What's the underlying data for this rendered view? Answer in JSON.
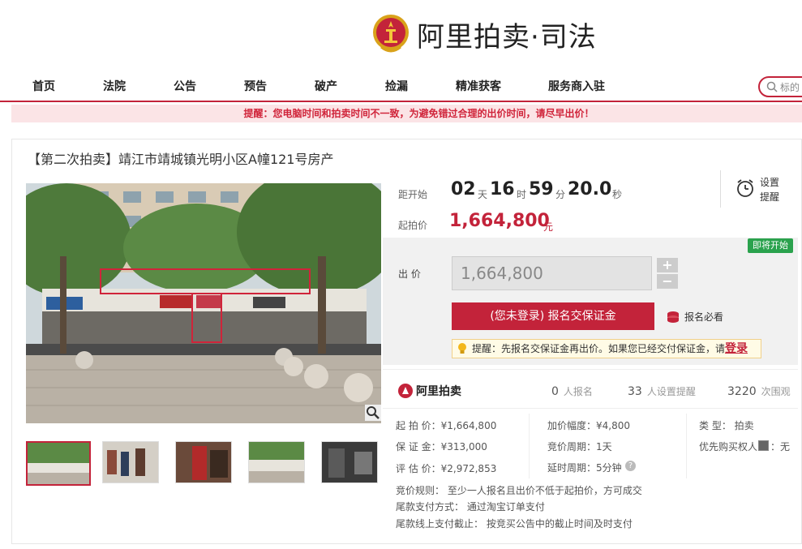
{
  "brand": {
    "title": "阿里拍卖·司法"
  },
  "nav": {
    "items": [
      "首页",
      "法院",
      "公告",
      "预告",
      "破产",
      "捡漏",
      "精准获客",
      "服务商入驻"
    ],
    "search_placeholder": "标的"
  },
  "notice": "提醒：您电脑时间和拍卖时间不一致，为避免错过合理的出价时间，请尽早出价！",
  "item": {
    "title": "【第二次拍卖】靖江市靖城镇光明小区A幢121号房产"
  },
  "countdown": {
    "label": "距开始",
    "days": "02",
    "days_unit": "天",
    "hours": "16",
    "hours_unit": "时",
    "minutes": "59",
    "minutes_unit": "分",
    "seconds": "20.0",
    "seconds_unit": "秒"
  },
  "start_price": {
    "label": "起拍价",
    "value": "1,664,800",
    "unit": "元"
  },
  "remind": {
    "line1": "设置",
    "line2": "提醒"
  },
  "status_badge": "即将开始",
  "bid": {
    "label": "出 价",
    "value": "1,664,800",
    "plus": "+",
    "minus": "−",
    "register_button": "(您未登录) 报名交保证金",
    "must_read": "报名必看",
    "tip_text": "提醒：先报名交保证金再出价。如果您已经交付保证金，请",
    "tip_link": "登录"
  },
  "stats": {
    "brand": "阿里拍卖",
    "signup_count": "0",
    "signup_label": "人报名",
    "reminder_count": "33",
    "reminder_label": "人设置提醒",
    "views_count": "3220",
    "views_label": "次围观"
  },
  "details": {
    "start_price": "起 拍 价：¥1,664,800",
    "deposit": "保 证 金：¥313,000",
    "valuation": "评 估 价：¥2,972,853",
    "increment": "加价幅度：¥4,800",
    "period": "竞价周期：1天",
    "extension": "延时周期：5分钟",
    "type": "类      型：  拍卖",
    "priority": "优先购买权人",
    "priority_value": "：无",
    "rule": "竞价规则： 至少一人报名且出价不低于起拍价，方可成交",
    "payment": "尾款支付方式： 通过淘宝订单支付",
    "deadline": "尾款线上支付截止： 按竞买公告中的截止时间及时支付"
  },
  "colors": {
    "accent": "#c3233a",
    "green": "#2aa24d"
  }
}
